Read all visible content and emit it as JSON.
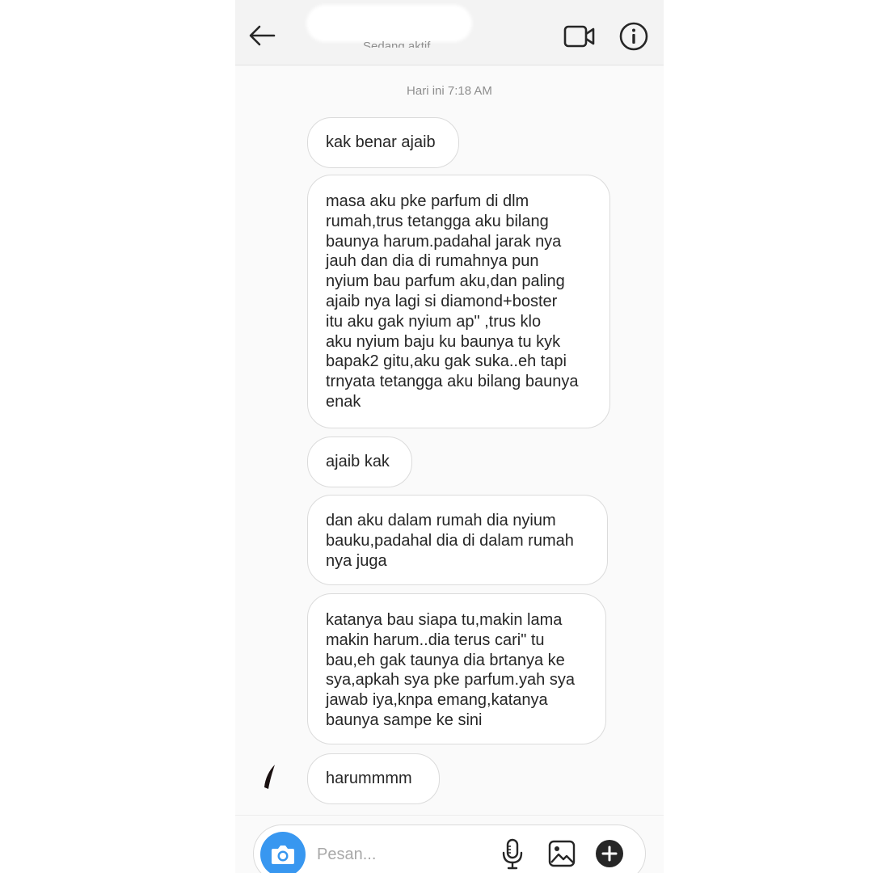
{
  "header": {
    "status_text": "Sedang aktif",
    "icons": {
      "back": "arrow-left-icon",
      "video": "video-camera-icon",
      "info": "info-icon"
    }
  },
  "timestamp": "Hari ini 7:18 AM",
  "messages": [
    {
      "text": "kak benar ajaib"
    },
    {
      "text": "masa aku pke parfum di dlm\nrumah,trus tetangga aku bilang\nbaunya harum.padahal jarak nya\njauh dan dia di rumahnya pun\nnyium bau parfum aku,dan paling\najaib nya lagi si diamond+boster\nitu aku gak nyium ap\" ,trus klo\naku nyium baju ku baunya tu kyk\nbapak2 gitu,aku gak suka..eh tapi\ntrnyata tetangga aku bilang baunya\nenak"
    },
    {
      "text": "ajaib kak"
    },
    {
      "text": "dan aku dalam rumah dia nyium\nbauku,padahal dia di dalam rumah\nnya juga"
    },
    {
      "text": "katanya bau siapa tu,makin lama\nmakin harum..dia terus cari\" tu\nbau,eh gak taunya dia brtanya ke\nsya,apkah sya pke parfum.yah sya\njawab iya,knpa emang,katanya\nbaunya sampe ke sini"
    },
    {
      "text": "harummmm"
    }
  ],
  "composer": {
    "placeholder": "Pesan...",
    "value": "",
    "accent_color": "#3897f0",
    "icons": {
      "camera": "camera-icon",
      "mic": "microphone-icon",
      "gallery": "image-gallery-icon",
      "plus": "plus-icon"
    }
  }
}
